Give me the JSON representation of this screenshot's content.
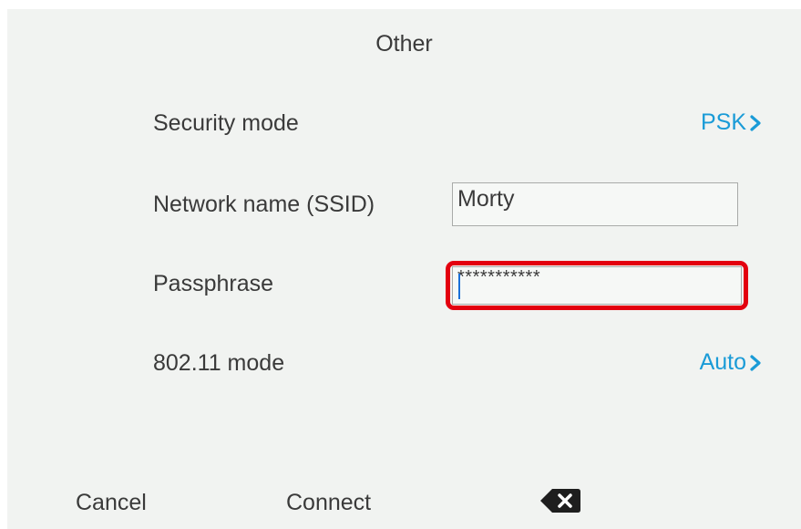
{
  "screen": {
    "title": "Other"
  },
  "form": {
    "security_mode": {
      "label": "Security mode",
      "value": "PSK"
    },
    "ssid": {
      "label": "Network name (SSID)",
      "value": "Morty"
    },
    "passphrase": {
      "label": "Passphrase",
      "value": "***********"
    },
    "wifi_mode": {
      "label": "802.11 mode",
      "value": "Auto"
    }
  },
  "softkeys": {
    "cancel": "Cancel",
    "connect": "Connect",
    "backspace_icon": "backspace-icon"
  },
  "colors": {
    "accent": "#1a9bd7",
    "highlight": "#e3000f",
    "background": "#f1f3f1"
  }
}
